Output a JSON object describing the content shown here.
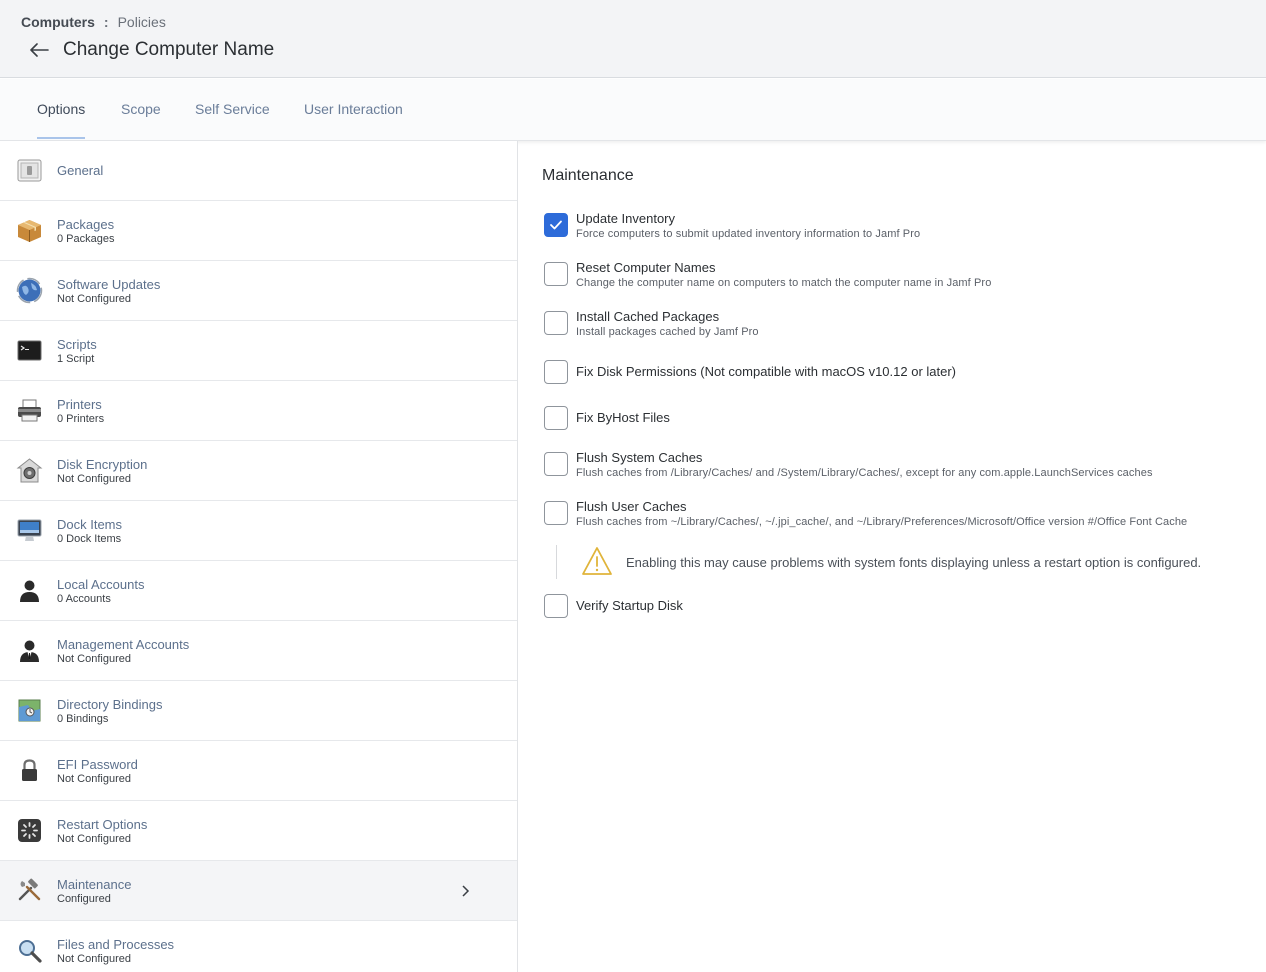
{
  "breadcrumb": {
    "root": "Computers",
    "separator": ":",
    "current": "Policies"
  },
  "page": {
    "title": "Change Computer Name"
  },
  "tabs": [
    {
      "label": "Options"
    },
    {
      "label": "Scope"
    },
    {
      "label": "Self Service"
    },
    {
      "label": "User Interaction"
    }
  ],
  "sidebar": {
    "items": [
      {
        "label": "General",
        "sub": ""
      },
      {
        "label": "Packages",
        "sub": "0 Packages"
      },
      {
        "label": "Software Updates",
        "sub": "Not Configured"
      },
      {
        "label": "Scripts",
        "sub": "1 Script"
      },
      {
        "label": "Printers",
        "sub": "0 Printers"
      },
      {
        "label": "Disk Encryption",
        "sub": "Not Configured"
      },
      {
        "label": "Dock Items",
        "sub": "0 Dock Items"
      },
      {
        "label": "Local Accounts",
        "sub": "0 Accounts"
      },
      {
        "label": "Management Accounts",
        "sub": "Not Configured"
      },
      {
        "label": "Directory Bindings",
        "sub": "0 Bindings"
      },
      {
        "label": "EFI Password",
        "sub": "Not Configured"
      },
      {
        "label": "Restart Options",
        "sub": "Not Configured"
      },
      {
        "label": "Maintenance",
        "sub": "Configured"
      },
      {
        "label": "Files and Processes",
        "sub": "Not Configured"
      }
    ]
  },
  "maintenance": {
    "title": "Maintenance",
    "options": [
      {
        "label": "Update Inventory",
        "desc": "Force computers to submit updated inventory information to Jamf Pro",
        "checked": true
      },
      {
        "label": "Reset Computer Names",
        "desc": "Change the computer name on computers to match the computer name in Jamf Pro",
        "checked": false
      },
      {
        "label": "Install Cached Packages",
        "desc": "Install packages cached by Jamf Pro",
        "checked": false
      },
      {
        "label": "Fix Disk Permissions (Not compatible with macOS v10.12 or later)",
        "desc": "",
        "checked": false
      },
      {
        "label": "Fix ByHost Files",
        "desc": "",
        "checked": false
      },
      {
        "label": "Flush System Caches",
        "desc": "Flush caches from /Library/Caches/ and /System/Library/Caches/, except for any com.apple.LaunchServices caches",
        "checked": false
      },
      {
        "label": "Flush User Caches",
        "desc": "Flush caches from ~/Library/Caches/, ~/.jpi_cache/, and ~/Library/Preferences/Microsoft/Office version #/Office Font Cache",
        "checked": false
      },
      {
        "label": "Verify Startup Disk",
        "desc": "",
        "checked": false
      }
    ],
    "warning": "Enabling this may cause problems with system fonts displaying unless a restart option is configured."
  },
  "colors": {
    "accent": "#2d6bd9",
    "link": "#5c708c",
    "warning": "#e0b43a"
  }
}
